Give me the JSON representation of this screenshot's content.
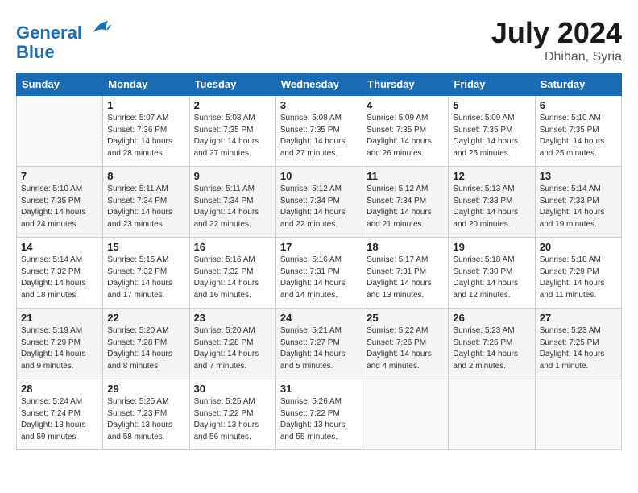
{
  "header": {
    "logo_line1": "General",
    "logo_line2": "Blue",
    "month_year": "July 2024",
    "location": "Dhiban, Syria"
  },
  "weekdays": [
    "Sunday",
    "Monday",
    "Tuesday",
    "Wednesday",
    "Thursday",
    "Friday",
    "Saturday"
  ],
  "weeks": [
    [
      {
        "day": "",
        "info": ""
      },
      {
        "day": "1",
        "info": "Sunrise: 5:07 AM\nSunset: 7:36 PM\nDaylight: 14 hours\nand 28 minutes."
      },
      {
        "day": "2",
        "info": "Sunrise: 5:08 AM\nSunset: 7:35 PM\nDaylight: 14 hours\nand 27 minutes."
      },
      {
        "day": "3",
        "info": "Sunrise: 5:08 AM\nSunset: 7:35 PM\nDaylight: 14 hours\nand 27 minutes."
      },
      {
        "day": "4",
        "info": "Sunrise: 5:09 AM\nSunset: 7:35 PM\nDaylight: 14 hours\nand 26 minutes."
      },
      {
        "day": "5",
        "info": "Sunrise: 5:09 AM\nSunset: 7:35 PM\nDaylight: 14 hours\nand 25 minutes."
      },
      {
        "day": "6",
        "info": "Sunrise: 5:10 AM\nSunset: 7:35 PM\nDaylight: 14 hours\nand 25 minutes."
      }
    ],
    [
      {
        "day": "7",
        "info": "Sunrise: 5:10 AM\nSunset: 7:35 PM\nDaylight: 14 hours\nand 24 minutes."
      },
      {
        "day": "8",
        "info": "Sunrise: 5:11 AM\nSunset: 7:34 PM\nDaylight: 14 hours\nand 23 minutes."
      },
      {
        "day": "9",
        "info": "Sunrise: 5:11 AM\nSunset: 7:34 PM\nDaylight: 14 hours\nand 22 minutes."
      },
      {
        "day": "10",
        "info": "Sunrise: 5:12 AM\nSunset: 7:34 PM\nDaylight: 14 hours\nand 22 minutes."
      },
      {
        "day": "11",
        "info": "Sunrise: 5:12 AM\nSunset: 7:34 PM\nDaylight: 14 hours\nand 21 minutes."
      },
      {
        "day": "12",
        "info": "Sunrise: 5:13 AM\nSunset: 7:33 PM\nDaylight: 14 hours\nand 20 minutes."
      },
      {
        "day": "13",
        "info": "Sunrise: 5:14 AM\nSunset: 7:33 PM\nDaylight: 14 hours\nand 19 minutes."
      }
    ],
    [
      {
        "day": "14",
        "info": "Sunrise: 5:14 AM\nSunset: 7:32 PM\nDaylight: 14 hours\nand 18 minutes."
      },
      {
        "day": "15",
        "info": "Sunrise: 5:15 AM\nSunset: 7:32 PM\nDaylight: 14 hours\nand 17 minutes."
      },
      {
        "day": "16",
        "info": "Sunrise: 5:16 AM\nSunset: 7:32 PM\nDaylight: 14 hours\nand 16 minutes."
      },
      {
        "day": "17",
        "info": "Sunrise: 5:16 AM\nSunset: 7:31 PM\nDaylight: 14 hours\nand 14 minutes."
      },
      {
        "day": "18",
        "info": "Sunrise: 5:17 AM\nSunset: 7:31 PM\nDaylight: 14 hours\nand 13 minutes."
      },
      {
        "day": "19",
        "info": "Sunrise: 5:18 AM\nSunset: 7:30 PM\nDaylight: 14 hours\nand 12 minutes."
      },
      {
        "day": "20",
        "info": "Sunrise: 5:18 AM\nSunset: 7:29 PM\nDaylight: 14 hours\nand 11 minutes."
      }
    ],
    [
      {
        "day": "21",
        "info": "Sunrise: 5:19 AM\nSunset: 7:29 PM\nDaylight: 14 hours\nand 9 minutes."
      },
      {
        "day": "22",
        "info": "Sunrise: 5:20 AM\nSunset: 7:28 PM\nDaylight: 14 hours\nand 8 minutes."
      },
      {
        "day": "23",
        "info": "Sunrise: 5:20 AM\nSunset: 7:28 PM\nDaylight: 14 hours\nand 7 minutes."
      },
      {
        "day": "24",
        "info": "Sunrise: 5:21 AM\nSunset: 7:27 PM\nDaylight: 14 hours\nand 5 minutes."
      },
      {
        "day": "25",
        "info": "Sunrise: 5:22 AM\nSunset: 7:26 PM\nDaylight: 14 hours\nand 4 minutes."
      },
      {
        "day": "26",
        "info": "Sunrise: 5:23 AM\nSunset: 7:26 PM\nDaylight: 14 hours\nand 2 minutes."
      },
      {
        "day": "27",
        "info": "Sunrise: 5:23 AM\nSunset: 7:25 PM\nDaylight: 14 hours\nand 1 minute."
      }
    ],
    [
      {
        "day": "28",
        "info": "Sunrise: 5:24 AM\nSunset: 7:24 PM\nDaylight: 13 hours\nand 59 minutes."
      },
      {
        "day": "29",
        "info": "Sunrise: 5:25 AM\nSunset: 7:23 PM\nDaylight: 13 hours\nand 58 minutes."
      },
      {
        "day": "30",
        "info": "Sunrise: 5:25 AM\nSunset: 7:22 PM\nDaylight: 13 hours\nand 56 minutes."
      },
      {
        "day": "31",
        "info": "Sunrise: 5:26 AM\nSunset: 7:22 PM\nDaylight: 13 hours\nand 55 minutes."
      },
      {
        "day": "",
        "info": ""
      },
      {
        "day": "",
        "info": ""
      },
      {
        "day": "",
        "info": ""
      }
    ]
  ]
}
